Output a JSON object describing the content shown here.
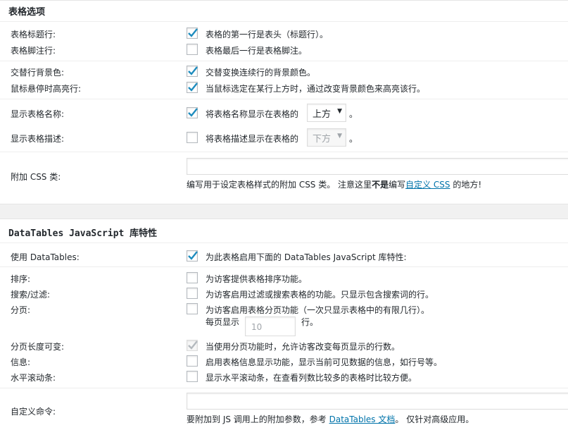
{
  "colors": {
    "link": "#0073aa",
    "check": "#1e8cbe",
    "background": "#f1f1f1",
    "panel": "#ffffff"
  },
  "table_options": {
    "title": "表格选项",
    "rows": [
      {
        "label": "表格标题行:",
        "checked": true,
        "description": "表格的第一行是表头（标题行）。"
      },
      {
        "label": "表格脚注行:",
        "checked": false,
        "description": "表格最后一行是表格脚注。"
      },
      {
        "label": "交替行背景色:",
        "checked": true,
        "description": "交替变换连续行的背景颜色。"
      },
      {
        "label": "鼠标悬停时高亮行:",
        "checked": true,
        "description": "当鼠标选定在某行上方时，通过改变背景颜色来高亮该行。"
      },
      {
        "label": "显示表格名称:",
        "checked": true,
        "description": "将表格名称显示在表格的",
        "select": "上方",
        "suffix": "。"
      },
      {
        "label": "显示表格描述:",
        "checked": false,
        "description": "将表格描述显示在表格的",
        "select": "下方",
        "suffix": "。"
      }
    ],
    "extra_css": {
      "label": "附加 CSS 类:",
      "value": "",
      "help_before": "编写用于设定表格样式的附加 CSS 类。 注意这里",
      "help_bold": "不是",
      "help_middle": "编写",
      "help_link": "自定义 CSS",
      "help_after": " 的地方!"
    }
  },
  "datatables": {
    "title": "DataTables JavaScript 库特性",
    "use": {
      "label": "使用 DataTables:",
      "checked": true,
      "description": "为此表格启用下面的 DataTables JavaScript 库特性:"
    },
    "rows": [
      {
        "label": "排序:",
        "checked": false,
        "description": "为访客提供表格排序功能。"
      },
      {
        "label": "搜索/过滤:",
        "checked": false,
        "description": "为访客启用过滤或搜索表格的功能。只显示包含搜索词的行。"
      },
      {
        "label": "分页:",
        "checked": false,
        "description": "为访客启用表格分页功能（一次只显示表格中的有限几行）。"
      }
    ],
    "per_page": {
      "prefix": "每页显示",
      "value": "10",
      "suffix": "行。"
    },
    "rows2": [
      {
        "label": "分页长度可变:",
        "checked": true,
        "disabled": true,
        "description": "当使用分页功能时，允许访客改变每页显示的行数。"
      },
      {
        "label": "信息:",
        "checked": false,
        "description": "启用表格信息显示功能，显示当前可见数据的信息，如行号等。"
      },
      {
        "label": "水平滚动条:",
        "checked": false,
        "description": "显示水平滚动条，在查看列数比较多的表格时比较方便。"
      }
    ],
    "custom_command": {
      "label": "自定义命令:",
      "value": "",
      "help_before": "要附加到 JS 调用上的附加参数，参考 ",
      "help_link": "DataTables 文档",
      "help_after": "。 仅针对高级应用。"
    }
  }
}
